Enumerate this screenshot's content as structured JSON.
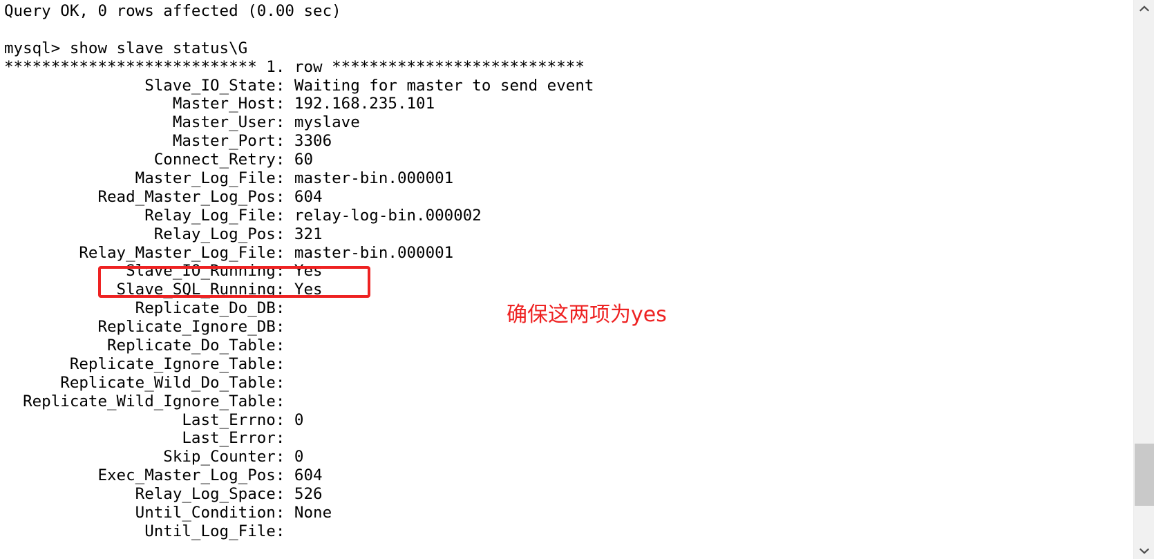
{
  "terminal": {
    "lines": [
      "Query OK, 0 rows affected (0.00 sec)",
      "",
      "mysql> show slave status\\G",
      "*************************** 1. row ***************************",
      "               Slave_IO_State: Waiting for master to send event",
      "                  Master_Host: 192.168.235.101",
      "                  Master_User: myslave",
      "                  Master_Port: 3306",
      "                Connect_Retry: 60",
      "              Master_Log_File: master-bin.000001",
      "          Read_Master_Log_Pos: 604",
      "               Relay_Log_File: relay-log-bin.000002",
      "                Relay_Log_Pos: 321",
      "        Relay_Master_Log_File: master-bin.000001",
      "             Slave_IO_Running: Yes",
      "            Slave_SQL_Running: Yes",
      "              Replicate_Do_DB:",
      "          Replicate_Ignore_DB:",
      "           Replicate_Do_Table:",
      "       Replicate_Ignore_Table:",
      "      Replicate_Wild_Do_Table:",
      "  Replicate_Wild_Ignore_Table:",
      "                   Last_Errno: 0",
      "                   Last_Error:",
      "                 Skip_Counter: 0",
      "          Exec_Master_Log_Pos: 604",
      "              Relay_Log_Space: 526",
      "              Until_Condition: None",
      "               Until_Log_File:"
    ]
  },
  "annotation": {
    "text": "确保这两项为yes",
    "color": "#ee2222"
  },
  "highlight": {
    "color": "#ee2222",
    "covers": [
      "Slave_IO_Running: Yes",
      "Slave_SQL_Running: Yes"
    ]
  },
  "scrollbar": {
    "up_arrow": "chevron-up-icon",
    "down_arrow": "chevron-down-icon",
    "thumb_color": "#c9c9c9",
    "track_color": "#f1f1f1"
  }
}
